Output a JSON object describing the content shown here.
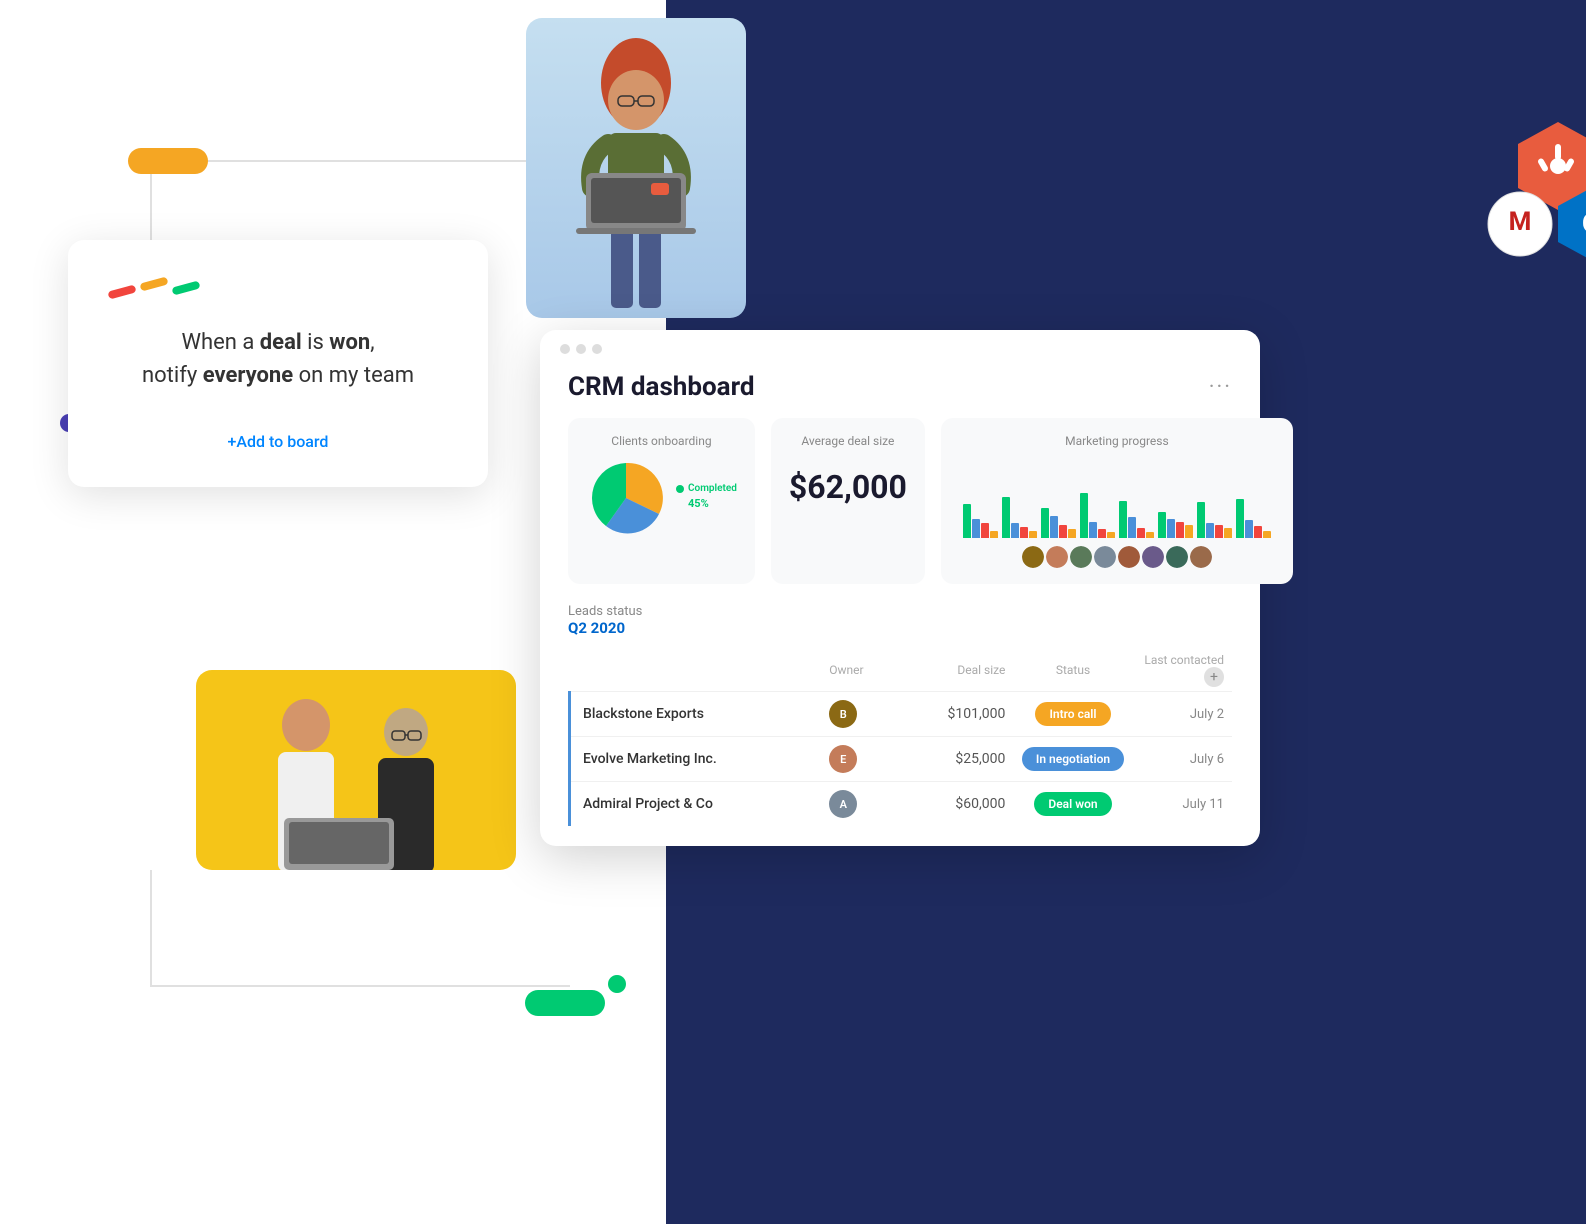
{
  "workflow": {
    "text_part1": "When a ",
    "text_bold1": "deal",
    "text_part2": " is ",
    "text_bold2": "won",
    "text_part3": ", notify ",
    "text_bold3": "everyone",
    "text_part4": " on my team",
    "add_label": "+Add to board"
  },
  "crm": {
    "title": "CRM dashboard",
    "more_icon": "···",
    "metrics": {
      "onboarding": {
        "title": "Clients onboarding",
        "completed_label": "Completed",
        "completed_pct": "45%"
      },
      "deal_size": {
        "title": "Average deal size",
        "value": "$62,000"
      },
      "marketing": {
        "title": "Marketing progress"
      }
    },
    "leads": {
      "title": "Leads status",
      "period": "Q2 2020",
      "columns": {
        "owner": "Owner",
        "deal_size": "Deal size",
        "status": "Status",
        "last_contacted": "Last contacted"
      },
      "rows": [
        {
          "company": "Blackstone Exports",
          "deal_size": "$101,000",
          "status": "Intro call",
          "status_class": "orange",
          "last_contacted": "July 2",
          "avatar_color": "#8B6914"
        },
        {
          "company": "Evolve Marketing Inc.",
          "deal_size": "$25,000",
          "status": "In negotiation",
          "status_class": "blue",
          "last_contacted": "July 6",
          "avatar_color": "#c47c5a"
        },
        {
          "company": "Admiral Project & Co",
          "deal_size": "$60,000",
          "status": "Deal won",
          "status_class": "green",
          "last_contacted": "July 11",
          "avatar_color": "#7a8a9a"
        }
      ]
    }
  },
  "integration": {
    "hubspot_label": "HubSpot",
    "gmail_label": "M",
    "outlook_label": "O"
  },
  "bar_chart": {
    "groups": [
      {
        "green": 45,
        "blue": 25,
        "red": 20,
        "yellow": 10
      },
      {
        "green": 55,
        "blue": 20,
        "red": 15,
        "yellow": 10
      },
      {
        "green": 40,
        "blue": 30,
        "red": 18,
        "yellow": 12
      },
      {
        "green": 60,
        "blue": 22,
        "red": 12,
        "yellow": 8
      },
      {
        "green": 50,
        "blue": 28,
        "red": 14,
        "yellow": 8
      },
      {
        "green": 35,
        "blue": 25,
        "red": 22,
        "yellow": 18
      },
      {
        "green": 48,
        "blue": 20,
        "red": 18,
        "yellow": 14
      },
      {
        "green": 52,
        "blue": 24,
        "red": 16,
        "yellow": 10
      }
    ]
  }
}
